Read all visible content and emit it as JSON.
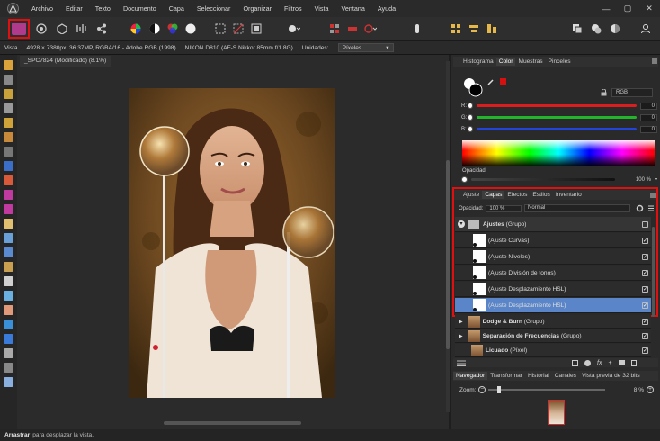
{
  "menu": [
    "Archivo",
    "Editar",
    "Texto",
    "Documento",
    "Capa",
    "Seleccionar",
    "Organizar",
    "Filtros",
    "Vista",
    "Ventana",
    "Ayuda"
  ],
  "window_controls": {
    "minimize": "—",
    "maximize": "▢",
    "close": "✕"
  },
  "context_bar": {
    "mode": "Vista",
    "image_info": "4928 × 7380px, 36.37MP, RGBA/16 - Adobe RGB (1998)",
    "camera": "NIKON D810 (AF-S Nikkor 85mm f/1.8G)",
    "units_label": "Unidades:",
    "units_value": "Píxeles"
  },
  "document": {
    "tab_title": "_SPC7824 (Modificado) (8.1%)"
  },
  "color_panel": {
    "tabs": [
      "Histograma",
      "Color",
      "Muestras",
      "Pinceles"
    ],
    "active_tab": "Color",
    "model": "RGB",
    "channels": [
      {
        "label": "R:",
        "value": "0",
        "color": "#d81e1e"
      },
      {
        "label": "G:",
        "value": "0",
        "color": "#21b62a"
      },
      {
        "label": "B:",
        "value": "0",
        "color": "#2244d8"
      }
    ],
    "opacity_label": "Opacidad",
    "opacity_value": "100 %"
  },
  "layers_panel": {
    "tabs": [
      "Ajuste",
      "Capas",
      "Efectos",
      "Estilos",
      "Inventario"
    ],
    "active_tab": "Capas",
    "opacity_label": "Opacidad:",
    "opacity_value": "100 %",
    "blend_mode": "Normal",
    "group": {
      "name": "Ajustes",
      "suffix": "(Grupo)"
    },
    "adjustments": [
      {
        "name": "(Ajuste Curvas)",
        "selected": false,
        "checked": true
      },
      {
        "name": "(Ajuste Niveles)",
        "selected": false,
        "checked": true
      },
      {
        "name": "(Ajuste División de tonos)",
        "selected": false,
        "checked": true
      },
      {
        "name": "(Ajuste Desplazamiento HSL)",
        "selected": false,
        "checked": true
      },
      {
        "name": "(Ajuste Desplazamiento HSL)",
        "selected": true,
        "checked": true
      }
    ],
    "other_layers": [
      {
        "name": "Dodge & Burn",
        "suffix": "(Grupo)"
      },
      {
        "name": "Separación de Frecuencias",
        "suffix": "(Grupo)"
      },
      {
        "name": "Licuado",
        "suffix": "(Píxel)"
      }
    ]
  },
  "navigator": {
    "tabs": [
      "Navegador",
      "Transformar",
      "Historial",
      "Canales",
      "Vista previa de 32 bits"
    ],
    "active_tab": "Navegador",
    "zoom_label": "Zoom:",
    "zoom_value": "8 %"
  },
  "status": {
    "action": "Arrastrar",
    "hint": "para desplazar la vista."
  },
  "colors": {
    "highlight": "#e01010",
    "selection": "#5a85c8",
    "bg": "#1e1e1e"
  }
}
